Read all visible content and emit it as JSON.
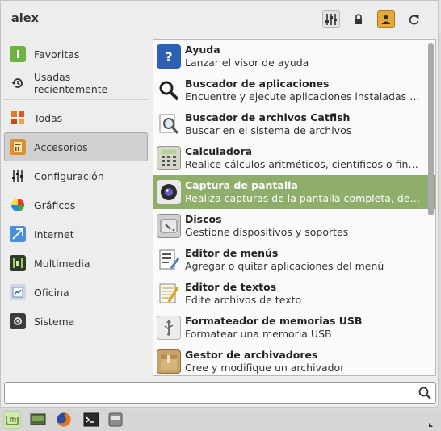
{
  "user": {
    "name": "alex"
  },
  "header_icons": [
    "control-center-icon",
    "lock-icon",
    "user-switch-icon",
    "logout-icon"
  ],
  "categories": [
    {
      "label": "Favoritas",
      "icon": "star-icon"
    },
    {
      "label": "Usadas recientemente",
      "icon": "history-icon"
    },
    {
      "label": "Todas",
      "icon": "all-apps-icon"
    },
    {
      "label": "Accesorios",
      "icon": "accessories-icon",
      "active": true
    },
    {
      "label": "Configuración",
      "icon": "settings-icon"
    },
    {
      "label": "Gráficos",
      "icon": "graphics-icon"
    },
    {
      "label": "Internet",
      "icon": "internet-icon"
    },
    {
      "label": "Multimedia",
      "icon": "multimedia-icon"
    },
    {
      "label": "Oficina",
      "icon": "office-icon"
    },
    {
      "label": "Sistema",
      "icon": "system-icon"
    }
  ],
  "apps": [
    {
      "title": "Ayuda",
      "desc": "Lanzar el visor de ayuda"
    },
    {
      "title": "Buscador de aplicaciones",
      "desc": "Encuentre y ejecute aplicaciones instaladas en el s..."
    },
    {
      "title": "Buscador de archivos Catfish",
      "desc": "Buscar en el sistema de archivos"
    },
    {
      "title": "Calculadora",
      "desc": "Realice cálculos aritméticos, científicos o financieros"
    },
    {
      "title": "Captura de pantalla",
      "desc": "Realiza capturas de la pantalla completa, de la ven...",
      "highlighted": true
    },
    {
      "title": "Discos",
      "desc": "Gestione dispositivos y soportes"
    },
    {
      "title": "Editor de menús",
      "desc": "Agregar o quitar aplicaciones  del menú"
    },
    {
      "title": "Editor de textos",
      "desc": "Edite archivos de texto"
    },
    {
      "title": "Formateador de memorias USB",
      "desc": "Formatear una memoria USB"
    },
    {
      "title": "Gestor de archivadores",
      "desc": "Cree y modifique un archivador"
    }
  ],
  "search": {
    "value": "",
    "placeholder": ""
  },
  "panel_icons": [
    "mint-menu-icon",
    "show-desktop-icon",
    "firefox-icon",
    "terminal-icon",
    "files-icon"
  ],
  "colors": {
    "highlight": "#8fae6b",
    "accent_mint": "#87b158"
  }
}
